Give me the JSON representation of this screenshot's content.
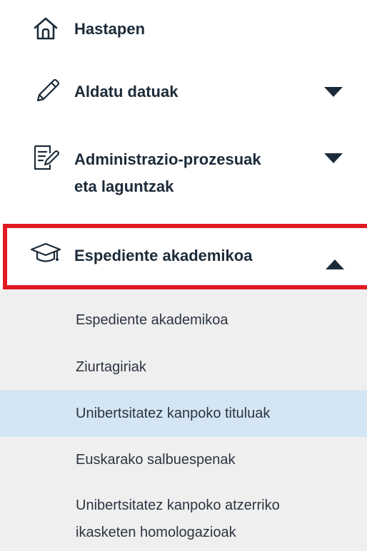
{
  "nav": {
    "items": [
      {
        "label": "Hastapen",
        "icon": "home-icon"
      },
      {
        "label": "Aldatu datuak",
        "icon": "pencil-icon",
        "expanded": false
      },
      {
        "label_line1": "Administrazio-prozesuak",
        "label_line2": "eta laguntzak",
        "icon": "document-edit-icon",
        "expanded": false
      },
      {
        "label": "Espediente akademikoa",
        "icon": "graduation-cap-icon",
        "expanded": true,
        "highlighted": true
      }
    ],
    "submenu": [
      {
        "label": "Espediente akademikoa"
      },
      {
        "label": "Ziurtagiriak"
      },
      {
        "label": "Unibertsitatez kanpoko tituluak",
        "selected": true
      },
      {
        "label": "Euskarako salbuespenak"
      },
      {
        "label_line1": "Unibertsitatez kanpoko atzerriko",
        "label_line2": "ikasketen homologazioak"
      }
    ]
  },
  "colors": {
    "text": "#1c2b39",
    "highlight_border": "#e11b22",
    "submenu_bg": "#efefef",
    "selected_bg": "#d4e6f4"
  }
}
